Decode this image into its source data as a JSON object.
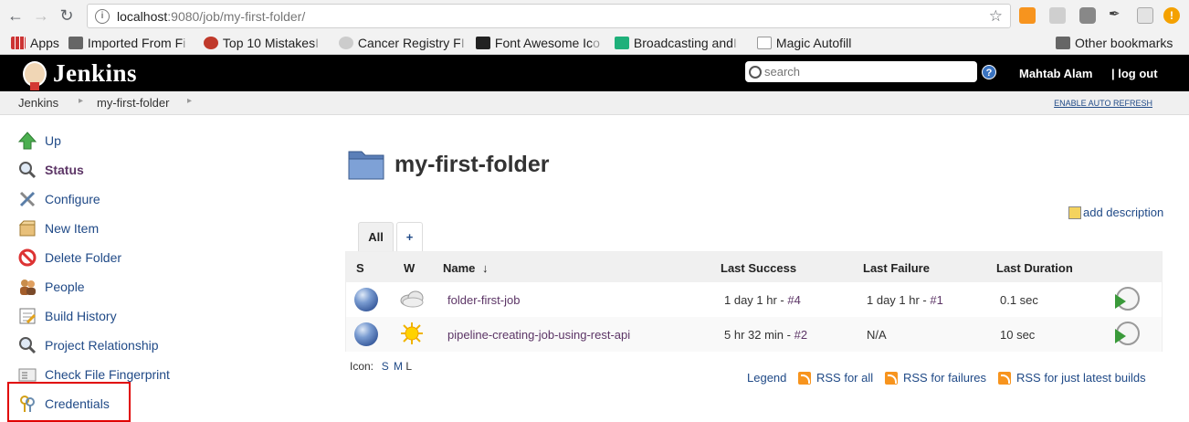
{
  "browser": {
    "url_host": "localhost",
    "url_rest": ":9080/job/my-first-folder/",
    "bookmarks": [
      {
        "label": "Apps",
        "fade": ""
      },
      {
        "label": "Imported From F",
        "fade": "i"
      },
      {
        "label": "Top 10 Mistakes ",
        "fade": "I"
      },
      {
        "label": "Cancer Registry F",
        "fade": "I"
      },
      {
        "label": "Font Awesome Ic",
        "fade": "o"
      },
      {
        "label": "Broadcasting and",
        "fade": "I"
      },
      {
        "label": "Magic Autofill",
        "fade": ""
      }
    ],
    "other_bookmarks": "Other bookmarks"
  },
  "header": {
    "brand": "Jenkins",
    "search_placeholder": "search",
    "user": "Mahtab Alam",
    "logout": "| log out"
  },
  "breadcrumb": {
    "items": [
      "Jenkins",
      "my-first-folder"
    ],
    "auto_refresh": "ENABLE AUTO REFRESH"
  },
  "sidebar": {
    "items": [
      {
        "label": "Up",
        "icon": "arrow-up-icon"
      },
      {
        "label": "Status",
        "icon": "magnifier-icon"
      },
      {
        "label": "Configure",
        "icon": "wrench-icon"
      },
      {
        "label": "New Item",
        "icon": "package-icon"
      },
      {
        "label": "Delete Folder",
        "icon": "no-icon"
      },
      {
        "label": "People",
        "icon": "people-icon"
      },
      {
        "label": "Build History",
        "icon": "notepad-icon"
      },
      {
        "label": "Project Relationship",
        "icon": "magnifier-icon"
      },
      {
        "label": "Check File Fingerprint",
        "icon": "fingerprint-icon"
      },
      {
        "label": "Credentials",
        "icon": "keys-icon"
      }
    ]
  },
  "main": {
    "title": "my-first-folder",
    "add_description": "add description",
    "tabs": {
      "all": "All",
      "add": "+"
    },
    "table": {
      "headers": {
        "s": "S",
        "w": "W",
        "name": "Name",
        "sort_arrow": "↓",
        "last_success": "Last Success",
        "last_failure": "Last Failure",
        "last_duration": "Last Duration"
      },
      "rows": [
        {
          "name": "folder-first-job",
          "success_text": "1 day 1 hr - ",
          "success_link": "#4",
          "failure_text": "1 day 1 hr - ",
          "failure_link": "#1",
          "duration": "0.1 sec",
          "weather": "cloudy"
        },
        {
          "name": "pipeline-creating-job-using-rest-api",
          "success_text": "5 hr 32 min - ",
          "success_link": "#2",
          "failure_text": "N/A",
          "failure_link": "",
          "duration": "10 sec",
          "weather": "sunny"
        }
      ]
    },
    "icon_label": "Icon:",
    "icon_sizes": {
      "s": "S",
      "m": "M",
      "l": "L"
    },
    "legend": "Legend",
    "rss_all": "RSS for all",
    "rss_failures": "RSS for failures",
    "rss_latest": "RSS for just latest builds"
  },
  "colors": {
    "link": "#204a87",
    "header_bg": "#000000",
    "highlight": "#e00000"
  }
}
